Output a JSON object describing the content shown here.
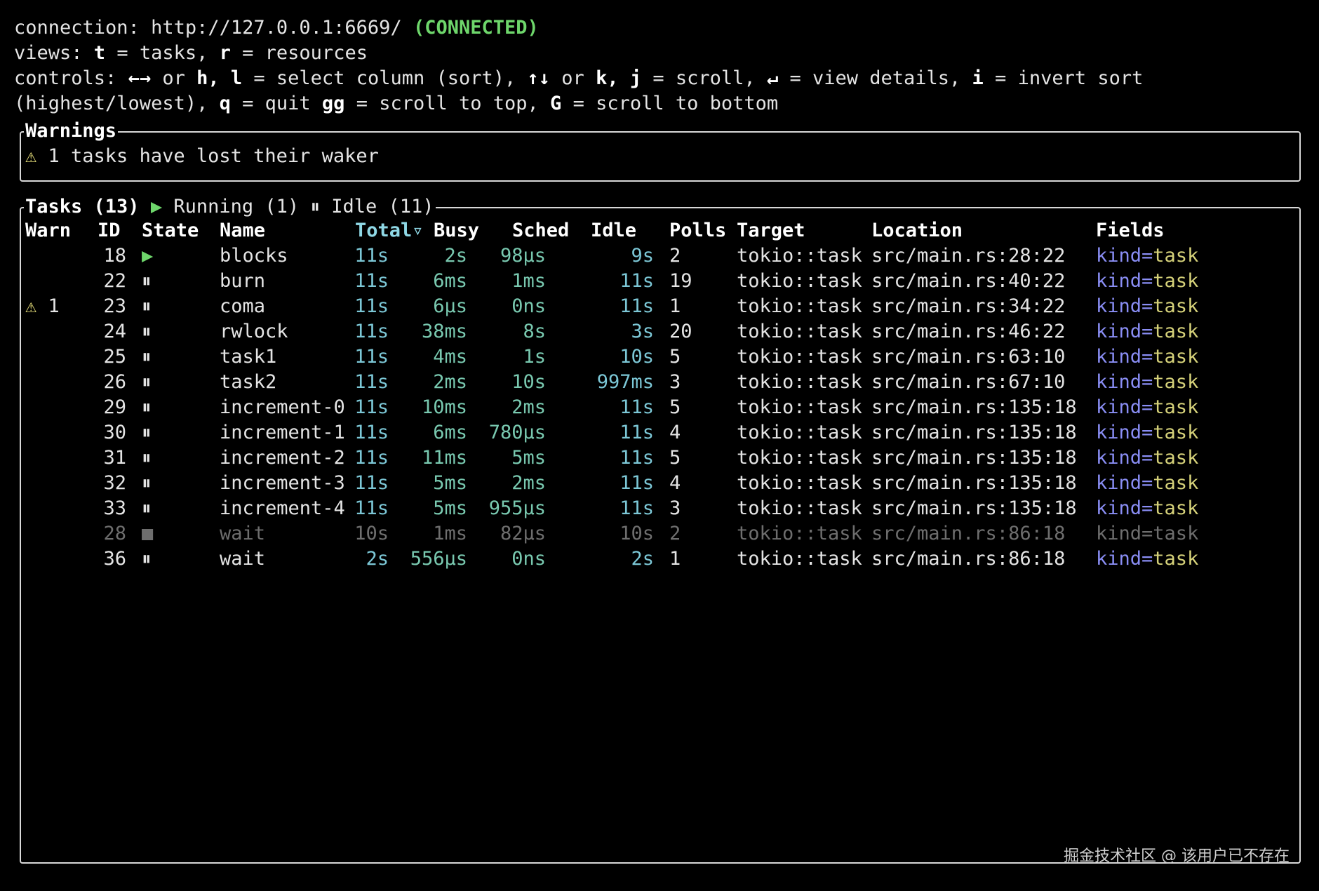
{
  "header": {
    "connection_label": "connection: ",
    "connection_url": "http://127.0.0.1:6669/",
    "connection_status": "(CONNECTED)",
    "views_label": "views: ",
    "views_t_key": "t",
    "views_t_text": " = tasks, ",
    "views_r_key": "r",
    "views_r_text": " = resources",
    "controls_label": "controls: ",
    "controls_lr_key": "←→",
    "controls_or1": " or ",
    "controls_hl_key": "h, l",
    "controls_select_text": " = select column (sort), ",
    "controls_ud_key": "↑↓",
    "controls_or2": " or ",
    "controls_kj_key": "k, j",
    "controls_scroll_text": " = scroll, ",
    "controls_enter_key": "↵",
    "controls_details_text": " = view details, ",
    "controls_i_key": "i",
    "controls_invert_text": " = invert sort",
    "controls2_prefix": "(highest/lowest), ",
    "controls_q_key": "q",
    "controls_quit_text": " = quit ",
    "controls_gg_key": "gg",
    "controls_top_text": " = scroll to top, ",
    "controls_G_key": "G",
    "controls_bottom_text": " = scroll to bottom"
  },
  "warnings": {
    "title": "Warnings",
    "icon": "⚠",
    "message": " 1 tasks have lost their waker"
  },
  "tasks": {
    "title": "Tasks (13)",
    "running_icon": "▶",
    "running_label": " Running (1)",
    "idle_icon": "⏸",
    "idle_label": " Idle (11)",
    "columns": {
      "warn": "Warn",
      "id": "ID",
      "state": "State",
      "name": "Name",
      "total": "Total▿",
      "busy": "Busy",
      "sched": "Sched",
      "idle": "Idle",
      "polls": "Polls",
      "target": "Target",
      "location": "Location",
      "fields": "Fields"
    },
    "rows": [
      {
        "warn": "",
        "id": "18",
        "state": "▶",
        "name": "blocks",
        "total": "11s",
        "busy": "2s",
        "sched": "98µs",
        "idle": "9s",
        "polls": "2",
        "target": "tokio::task",
        "location": "src/main.rs:28:22",
        "field_key": "kind",
        "field_eq": "=",
        "field_val": "task"
      },
      {
        "warn": "",
        "id": "22",
        "state": "⏸",
        "name": "burn",
        "total": "11s",
        "busy": "6ms",
        "sched": "1ms",
        "idle": "11s",
        "polls": "19",
        "target": "tokio::task",
        "location": "src/main.rs:40:22",
        "field_key": "kind",
        "field_eq": "=",
        "field_val": "task"
      },
      {
        "warn": "⚠ 1",
        "id": "23",
        "state": "⏸",
        "name": "coma",
        "total": "11s",
        "busy": "6µs",
        "sched": "0ns",
        "idle": "11s",
        "polls": "1",
        "target": "tokio::task",
        "location": "src/main.rs:34:22",
        "field_key": "kind",
        "field_eq": "=",
        "field_val": "task"
      },
      {
        "warn": "",
        "id": "24",
        "state": "⏸",
        "name": "rwlock",
        "total": "11s",
        "busy": "38ms",
        "sched": "8s",
        "idle": "3s",
        "polls": "20",
        "target": "tokio::task",
        "location": "src/main.rs:46:22",
        "field_key": "kind",
        "field_eq": "=",
        "field_val": "task"
      },
      {
        "warn": "",
        "id": "25",
        "state": "⏸",
        "name": "task1",
        "total": "11s",
        "busy": "4ms",
        "sched": "1s",
        "idle": "10s",
        "polls": "5",
        "target": "tokio::task",
        "location": "src/main.rs:63:10",
        "field_key": "kind",
        "field_eq": "=",
        "field_val": "task"
      },
      {
        "warn": "",
        "id": "26",
        "state": "⏸",
        "name": "task2",
        "total": "11s",
        "busy": "2ms",
        "sched": "10s",
        "idle": "997ms",
        "polls": "3",
        "target": "tokio::task",
        "location": "src/main.rs:67:10",
        "field_key": "kind",
        "field_eq": "=",
        "field_val": "task"
      },
      {
        "warn": "",
        "id": "29",
        "state": "⏸",
        "name": "increment-0",
        "total": "11s",
        "busy": "10ms",
        "sched": "2ms",
        "idle": "11s",
        "polls": "5",
        "target": "tokio::task",
        "location": "src/main.rs:135:18",
        "field_key": "kind",
        "field_eq": "=",
        "field_val": "task"
      },
      {
        "warn": "",
        "id": "30",
        "state": "⏸",
        "name": "increment-1",
        "total": "11s",
        "busy": "6ms",
        "sched": "780µs",
        "idle": "11s",
        "polls": "4",
        "target": "tokio::task",
        "location": "src/main.rs:135:18",
        "field_key": "kind",
        "field_eq": "=",
        "field_val": "task"
      },
      {
        "warn": "",
        "id": "31",
        "state": "⏸",
        "name": "increment-2",
        "total": "11s",
        "busy": "11ms",
        "sched": "5ms",
        "idle": "11s",
        "polls": "5",
        "target": "tokio::task",
        "location": "src/main.rs:135:18",
        "field_key": "kind",
        "field_eq": "=",
        "field_val": "task"
      },
      {
        "warn": "",
        "id": "32",
        "state": "⏸",
        "name": "increment-3",
        "total": "11s",
        "busy": "5ms",
        "sched": "2ms",
        "idle": "11s",
        "polls": "4",
        "target": "tokio::task",
        "location": "src/main.rs:135:18",
        "field_key": "kind",
        "field_eq": "=",
        "field_val": "task"
      },
      {
        "warn": "",
        "id": "33",
        "state": "⏸",
        "name": "increment-4",
        "total": "11s",
        "busy": "5ms",
        "sched": "955µs",
        "idle": "11s",
        "polls": "3",
        "target": "tokio::task",
        "location": "src/main.rs:135:18",
        "field_key": "kind",
        "field_eq": "=",
        "field_val": "task"
      },
      {
        "warn": "",
        "id": "28",
        "state": "■",
        "name": "wait",
        "total": "10s",
        "busy": "1ms",
        "sched": "82µs",
        "idle": "10s",
        "polls": "2",
        "target": "tokio::task",
        "location": "src/main.rs:86:18",
        "field_key": "kind",
        "field_eq": "=",
        "field_val": "task",
        "dead": true
      },
      {
        "warn": "",
        "id": "36",
        "state": "⏸",
        "name": "wait",
        "total": "2s",
        "busy": "556µs",
        "sched": "0ns",
        "idle": "2s",
        "polls": "1",
        "target": "tokio::task",
        "location": "src/main.rs:86:18",
        "field_key": "kind",
        "field_eq": "=",
        "field_val": "task"
      }
    ]
  },
  "watermark": "掘金技术社区 @ 该用户已不存在",
  "colors": {
    "background": "#000000",
    "connected": "#6ed66b",
    "running_icon": "#6ed66b",
    "warning_icon": "#e8e07a",
    "sorted_header": "#8fd8e6",
    "field_key": "#8a8ef5",
    "field_value": "#d6d27a"
  }
}
